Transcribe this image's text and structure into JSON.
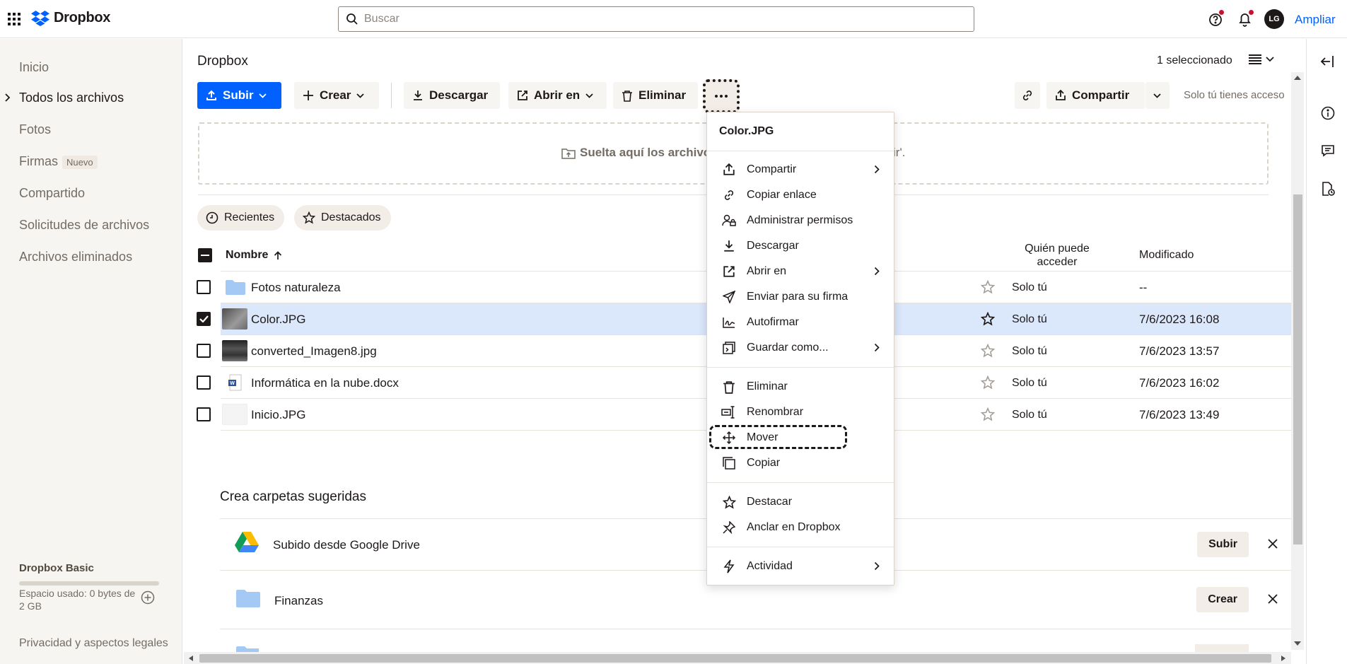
{
  "app": {
    "name": "Dropbox"
  },
  "topbar": {
    "search_placeholder": "Buscar",
    "avatar_initials": "LG",
    "upgrade_label": "Ampliar"
  },
  "sidebar": {
    "items": [
      {
        "label": "Inicio"
      },
      {
        "label": "Todos los archivos"
      },
      {
        "label": "Fotos"
      },
      {
        "label": "Firmas",
        "badge": "Nuevo"
      },
      {
        "label": "Compartido"
      },
      {
        "label": "Solicitudes de archivos"
      },
      {
        "label": "Archivos eliminados"
      }
    ],
    "plan": "Dropbox Basic",
    "usage_text": "Espacio usado: 0 bytes de 2 GB",
    "usage_fraction": 0,
    "legal": "Privacidad y aspectos legales"
  },
  "main": {
    "title": "Dropbox",
    "selection_count": "1 seleccionado",
    "toolbar": {
      "upload": "Subir",
      "create": "Crear",
      "download": "Descargar",
      "open_in": "Abrir en",
      "delete": "Eliminar",
      "share": "Compartir",
      "access_note": "Solo tú tienes acceso"
    },
    "dropzone": {
      "left_text": "Suelta aquí los archivos",
      "right_text": "ir'."
    },
    "filters": {
      "recent": "Recientes",
      "starred": "Destacados"
    },
    "columns": {
      "name": "Nombre",
      "who": "Quién puede acceder",
      "modified": "Modificado"
    },
    "files": [
      {
        "name": "Fotos naturaleza",
        "who": "Solo tú",
        "modified": "--",
        "selected": false,
        "starred": false,
        "kind": "folder"
      },
      {
        "name": "Color.JPG",
        "who": "Solo tú",
        "modified": "7/6/2023 16:08",
        "selected": true,
        "starred": false,
        "kind": "image"
      },
      {
        "name": "converted_Imagen8.jpg",
        "who": "Solo tú",
        "modified": "7/6/2023 13:57",
        "selected": false,
        "starred": false,
        "kind": "image"
      },
      {
        "name": "Informática en la nube.docx",
        "who": "Solo tú",
        "modified": "7/6/2023 16:02",
        "selected": false,
        "starred": false,
        "kind": "docx"
      },
      {
        "name": "Inicio.JPG",
        "who": "Solo tú",
        "modified": "7/6/2023 13:49",
        "selected": false,
        "starred": false,
        "kind": "image"
      }
    ],
    "suggestions": {
      "title": "Crea carpetas sugeridas",
      "items": [
        {
          "name": "Subido desde Google Drive",
          "action": "Subir"
        },
        {
          "name": "Finanzas",
          "action": "Crear"
        }
      ]
    }
  },
  "context_menu": {
    "title": "Color.JPG",
    "groups": [
      [
        {
          "label": "Compartir",
          "submenu": true,
          "icon": "share-icon"
        },
        {
          "label": "Copiar enlace",
          "submenu": false,
          "icon": "link-icon"
        },
        {
          "label": "Administrar permisos",
          "submenu": false,
          "icon": "permissions-icon"
        },
        {
          "label": "Descargar",
          "submenu": false,
          "icon": "download-icon"
        },
        {
          "label": "Abrir en",
          "submenu": true,
          "icon": "open-external-icon"
        },
        {
          "label": "Enviar para su firma",
          "submenu": false,
          "icon": "send-icon"
        },
        {
          "label": "Autofirmar",
          "submenu": false,
          "icon": "signature-icon"
        },
        {
          "label": "Guardar como...",
          "submenu": true,
          "icon": "save-as-icon"
        }
      ],
      [
        {
          "label": "Eliminar",
          "submenu": false,
          "icon": "trash-icon"
        },
        {
          "label": "Renombrar",
          "submenu": false,
          "icon": "rename-icon"
        },
        {
          "label": "Mover",
          "submenu": false,
          "icon": "move-icon"
        },
        {
          "label": "Copiar",
          "submenu": false,
          "icon": "copy-icon"
        }
      ],
      [
        {
          "label": "Destacar",
          "submenu": false,
          "icon": "star-icon"
        },
        {
          "label": "Anclar en Dropbox",
          "submenu": false,
          "icon": "pin-icon"
        }
      ],
      [
        {
          "label": "Actividad",
          "submenu": true,
          "icon": "activity-icon"
        }
      ]
    ]
  },
  "colors": {
    "accent": "#0061fe",
    "selected_row": "#dbe7fb",
    "sidebar_bg": "#f7f5f2"
  }
}
